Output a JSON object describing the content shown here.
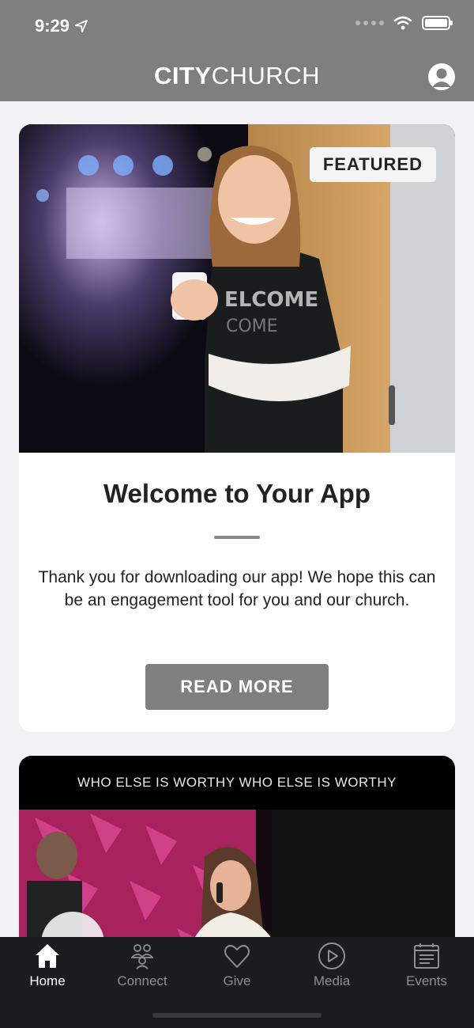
{
  "status_bar": {
    "time": "9:29"
  },
  "header": {
    "brand_bold": "CITY",
    "brand_light": "CHURCH"
  },
  "featured_card": {
    "badge": "FEATURED",
    "title": "Welcome to Your App",
    "body": "Thank you for downloading our app! We hope this can be an engagement tool for you and our church.",
    "button_label": "READ MORE"
  },
  "media_card": {
    "banner": "WHO ELSE IS WORTHY WHO ELSE IS WORTHY"
  },
  "tab_bar": {
    "items": [
      {
        "label": "Home",
        "icon": "home-icon",
        "active": true
      },
      {
        "label": "Connect",
        "icon": "people-icon",
        "active": false
      },
      {
        "label": "Give",
        "icon": "heart-icon",
        "active": false
      },
      {
        "label": "Media",
        "icon": "play-icon",
        "active": false
      },
      {
        "label": "Events",
        "icon": "calendar-icon",
        "active": false
      }
    ]
  },
  "colors": {
    "header_bg": "#7f7f7f",
    "tab_bar_bg": "#1c1c1e",
    "button_bg": "#7f7f7f",
    "page_bg": "#f2f2f4"
  }
}
